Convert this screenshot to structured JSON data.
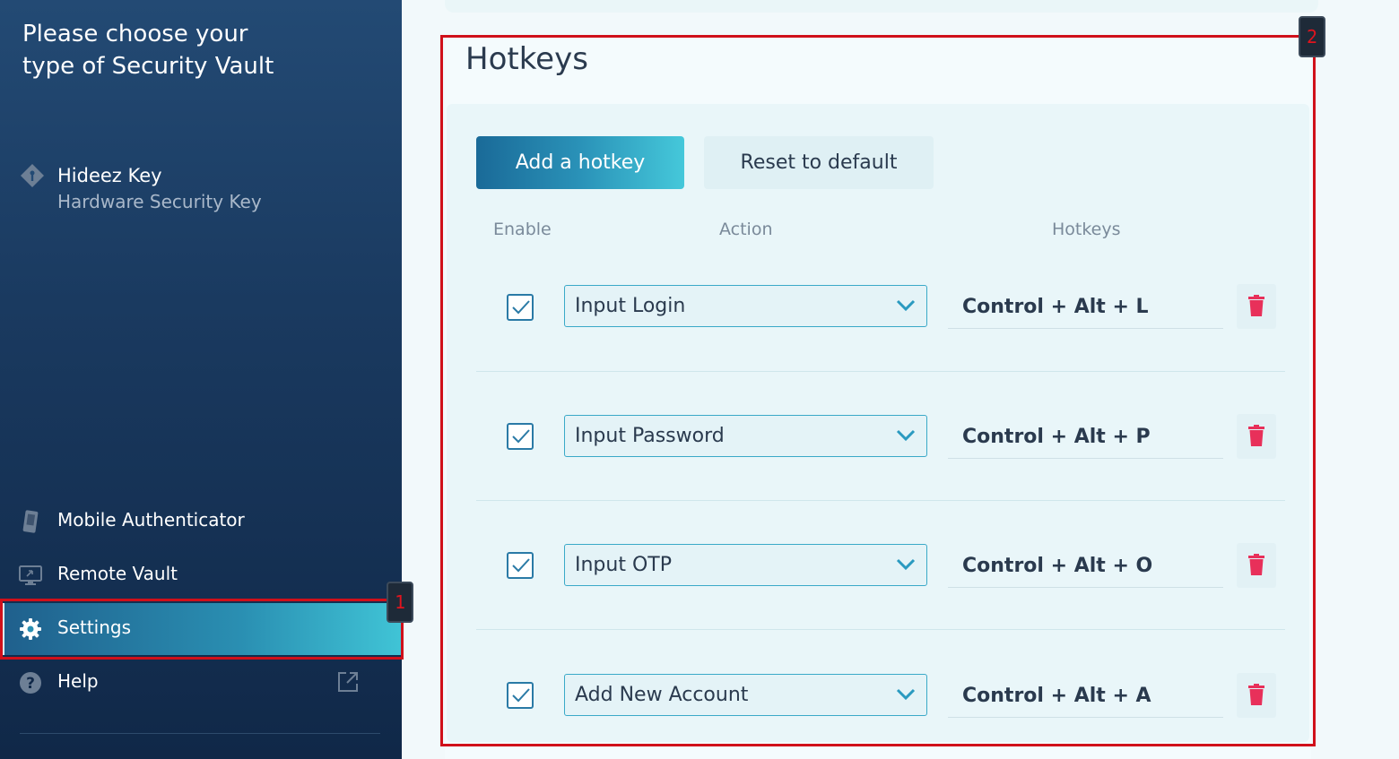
{
  "sidebar": {
    "title": "Please choose your type of Security Vault",
    "hideez": {
      "name": "Hideez Key",
      "subtitle": "Hardware Security Key"
    },
    "items": [
      {
        "label": "Mobile Authenticator",
        "icon": "phone-icon"
      },
      {
        "label": "Remote Vault",
        "icon": "monitor-icon"
      },
      {
        "label": "Settings",
        "icon": "gear-icon",
        "active": true
      },
      {
        "label": "Help",
        "icon": "help-icon"
      }
    ]
  },
  "markers": {
    "one": "1",
    "two": "2"
  },
  "hotkeys": {
    "title": "Hotkeys",
    "add_label": "Add a hotkey",
    "reset_label": "Reset to default",
    "columns": {
      "enable": "Enable",
      "action": "Action",
      "hotkeys": "Hotkeys"
    },
    "rows": [
      {
        "enabled": true,
        "action": "Input Login",
        "hotkey": "Control + Alt + L"
      },
      {
        "enabled": true,
        "action": "Input Password",
        "hotkey": "Control + Alt + P"
      },
      {
        "enabled": true,
        "action": "Input OTP",
        "hotkey": "Control + Alt + O"
      },
      {
        "enabled": true,
        "action": "Add New Account",
        "hotkey": "Control + Alt + A"
      }
    ]
  },
  "colors": {
    "accent": "#2a92b8",
    "delete": "#e8305a",
    "marker": "#d0101a"
  }
}
